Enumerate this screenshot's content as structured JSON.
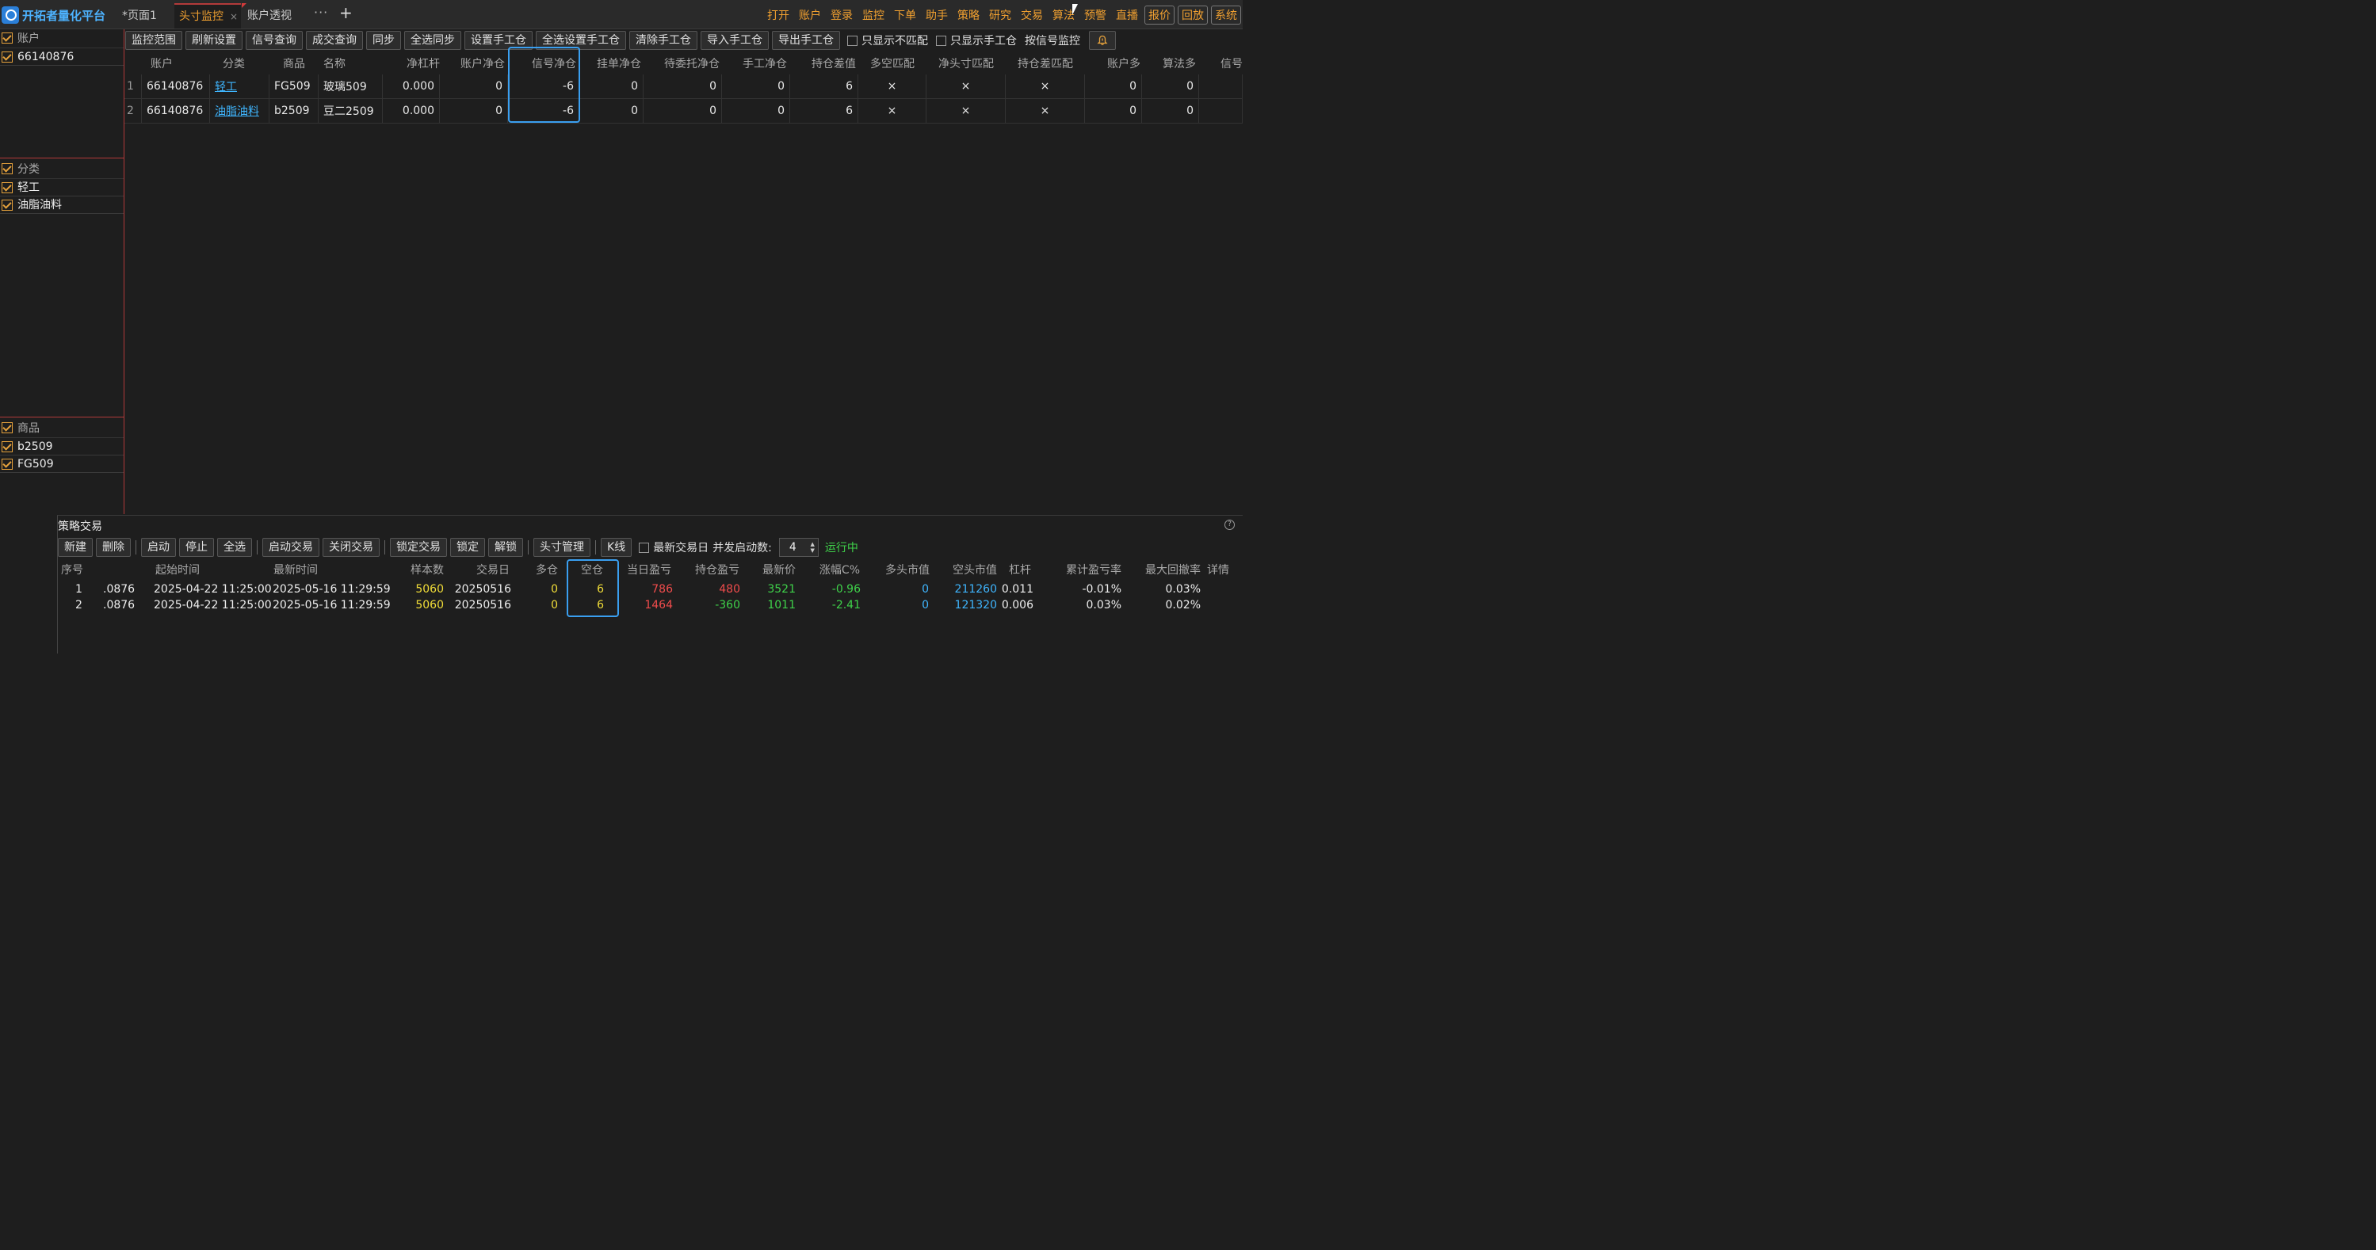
{
  "app": {
    "title": "开拓者量化平台",
    "tabs": [
      {
        "label": "*页面1"
      },
      {
        "label": "头寸监控",
        "close": "×"
      },
      {
        "label": "账户透视"
      }
    ],
    "more": "···",
    "add": "+",
    "menu": [
      "打开",
      "账户",
      "登录",
      "监控",
      "下单",
      "助手",
      "策略",
      "研究",
      "交易",
      "算法",
      "预警",
      "直播"
    ],
    "menu_buttons": [
      "报价",
      "回放",
      "系统"
    ]
  },
  "left": {
    "accounts_header": "账户",
    "accounts": [
      "66140876"
    ],
    "categories_header": "分类",
    "categories": [
      "轻工",
      "油脂油料"
    ],
    "products_header": "商品",
    "products": [
      "b2509",
      "FG509"
    ]
  },
  "toolbar": {
    "buttons": [
      "监控范围",
      "刷新设置",
      "信号查询",
      "成交查询",
      "同步",
      "全选同步",
      "设置手工仓",
      "全选设置手工仓",
      "清除手工仓",
      "导入手工仓",
      "导出手工仓"
    ],
    "check_unmatched": "只显示不匹配",
    "check_manual": "只显示手工仓",
    "signal_monitor": "按信号监控"
  },
  "main_table": {
    "columns": [
      "账户",
      "分类",
      "商品",
      "名称",
      "净杠杆",
      "账户净仓",
      "信号净仓",
      "挂单净仓",
      "待委托净仓",
      "手工净仓",
      "持仓差值",
      "多空匹配",
      "净头寸匹配",
      "持仓差匹配",
      "账户多",
      "算法多",
      "信号"
    ],
    "rows": [
      {
        "idx": "1",
        "account": "66140876",
        "category": "轻工",
        "product": "FG509",
        "name": "玻璃509",
        "leverage": "0.000",
        "acct_net": "0",
        "signal_net": "-6",
        "pending_net": "0",
        "to_order_net": "0",
        "manual_net": "0",
        "diff": "6",
        "ls_match": "×",
        "net_match": "×",
        "diff_match": "×",
        "acct_long": "0",
        "algo_long": "0"
      },
      {
        "idx": "2",
        "account": "66140876",
        "category": "油脂油料",
        "product": "b2509",
        "name": "豆二2509",
        "leverage": "0.000",
        "acct_net": "0",
        "signal_net": "-6",
        "pending_net": "0",
        "to_order_net": "0",
        "manual_net": "0",
        "diff": "6",
        "ls_match": "×",
        "net_match": "×",
        "diff_match": "×",
        "acct_long": "0",
        "algo_long": "0"
      }
    ]
  },
  "strategy": {
    "title": "策略交易",
    "help": "?",
    "buttons_a": [
      "新建",
      "删除"
    ],
    "buttons_b": [
      "启动",
      "停止",
      "全选"
    ],
    "buttons_c": [
      "启动交易",
      "关闭交易"
    ],
    "buttons_d": [
      "锁定交易",
      "锁定",
      "解锁"
    ],
    "buttons_e": [
      "头寸管理"
    ],
    "buttons_f": [
      "K线"
    ],
    "latest_day": "最新交易日",
    "concurrency_label": "并发启动数:",
    "concurrency_value": "4",
    "status": "运行中",
    "columns": [
      "序号",
      "起始时间",
      "最新时间",
      "样本数",
      "交易日",
      "多仓",
      "空仓",
      "当日盈亏",
      "持仓盈亏",
      "最新价",
      "涨幅C%",
      "多头市值",
      "空头市值",
      "杠杆",
      "累计盈亏率",
      "最大回撤率",
      "详情"
    ],
    "rows": [
      {
        "idx": "1",
        "acct": ".0876",
        "start": "2025-04-22 11:25:00",
        "latest": "2025-05-16 11:29:59",
        "samples": "5060",
        "trade_day": "20250516",
        "long": "0",
        "short": "6",
        "day_pnl": "786",
        "pos_pnl": "480",
        "price": "3521",
        "chg": "-0.96",
        "long_mv": "0",
        "short_mv": "211260",
        "lev": "0.011",
        "cum": "-0.01%",
        "mdd": "0.03%"
      },
      {
        "idx": "2",
        "acct": ".0876",
        "start": "2025-04-22 11:25:00",
        "latest": "2025-05-16 11:29:59",
        "samples": "5060",
        "trade_day": "20250516",
        "long": "0",
        "short": "6",
        "day_pnl": "1464",
        "pos_pnl": "-360",
        "price": "1011",
        "chg": "-2.41",
        "long_mv": "0",
        "short_mv": "121320",
        "lev": "0.006",
        "cum": "0.03%",
        "mdd": "0.02%"
      }
    ]
  },
  "colors": {
    "accent": "#f0a030",
    "highlight": "#3a9ff0",
    "link": "#3fb6ff"
  }
}
